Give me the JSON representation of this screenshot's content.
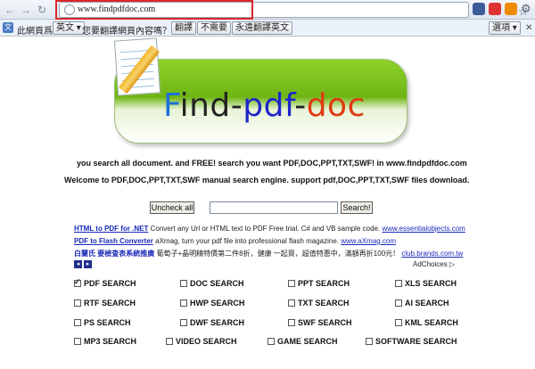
{
  "browser": {
    "url": "www.findpdfdoc.com"
  },
  "translate_bar": {
    "page_lang_label": "此網頁爲",
    "lang": "英文",
    "question": "您要翻譯網頁內容嗎？",
    "translate_btn": "翻譯",
    "no_btn": "不需要",
    "always_btn": "永遠翻譯英文",
    "options_btn": "選項"
  },
  "logo": {
    "part1": "F",
    "part2": "ind-",
    "part3": "pdf",
    "part4": "-",
    "part5": "doc"
  },
  "intro": {
    "line1": "you search all document. and FREE! search you want PDF,DOC,PPT,TXT,SWF! in www.findpdfdoc.com",
    "line2": "Welcome to PDF,DOC,PPT,TXT,SWF manual search engine. support pdf,DOC,PPT,TXT,SWF files download."
  },
  "search": {
    "uncheck_label": "Uncheck all",
    "input_value": "",
    "button_label": "Search!"
  },
  "ads": [
    {
      "title": "HTML to PDF for .NET",
      "text": " Convert any Url or HTML text to PDF Free trial. C# and VB sample code. ",
      "url": "www.essentialobjects.com"
    },
    {
      "title": "PDF to Flash Converter",
      "text": " aXmag, turn your pdf file into professional flash magazine. ",
      "url": "www.aXmag.com"
    },
    {
      "title": "白蘭氏 要檢查表系統推廣",
      "text": " 葡萄子+晶明精特價第二件8折，健康 一起買，超值特惠中，滿額再折100元！ ",
      "url": "club.brands.com.tw"
    }
  ],
  "adchoices": "AdChoices",
  "categories": [
    {
      "label": "PDF SEARCH",
      "checked": true
    },
    {
      "label": "DOC SEARCH",
      "checked": false
    },
    {
      "label": "PPT SEARCH",
      "checked": false
    },
    {
      "label": "XLS SEARCH",
      "checked": false
    },
    {
      "label": "RTF SEARCH",
      "checked": false
    },
    {
      "label": "HWP SEARCH",
      "checked": false
    },
    {
      "label": "TXT SEARCH",
      "checked": false
    },
    {
      "label": "AI SEARCH",
      "checked": false
    },
    {
      "label": "PS SEARCH",
      "checked": false
    },
    {
      "label": "DWF SEARCH",
      "checked": false
    },
    {
      "label": "SWF SEARCH",
      "checked": false
    },
    {
      "label": "KML SEARCH",
      "checked": false
    },
    {
      "label": "MP3 SEARCH",
      "checked": false
    },
    {
      "label": "VIDEO SEARCH",
      "checked": false
    },
    {
      "label": "GAME SEARCH",
      "checked": false
    },
    {
      "label": "SOFTWARE SEARCH",
      "checked": false
    }
  ],
  "colors": {
    "logo_f": "#1e6fd9",
    "logo_ind": "#222222",
    "logo_pdf": "#1f25c8",
    "logo_doc": "#e03a12",
    "accent_red": "#d9262b"
  }
}
